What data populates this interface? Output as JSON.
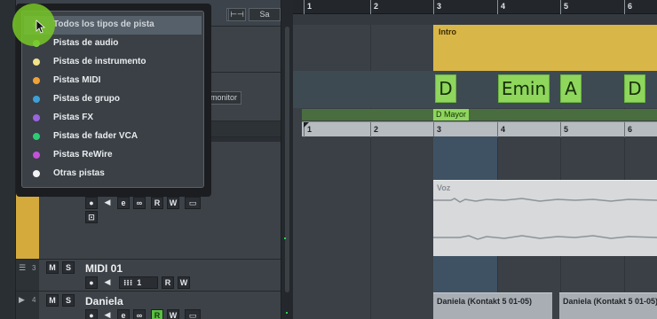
{
  "track_type_menu": {
    "items": [
      {
        "label": "Todos los tipos de pista",
        "color": "#5fa64a",
        "selected": true
      },
      {
        "label": "Pistas de audio",
        "color": "#7ed348",
        "selected": false
      },
      {
        "label": "Pistas de instrumento",
        "color": "#f2e38a",
        "selected": false
      },
      {
        "label": "Pistas MIDI",
        "color": "#f0a23a",
        "selected": false
      },
      {
        "label": "Pistas de grupo",
        "color": "#3da0d8",
        "selected": false
      },
      {
        "label": "Pistas FX",
        "color": "#9c63e0",
        "selected": false
      },
      {
        "label": "Pistas de fader VCA",
        "color": "#2ecb76",
        "selected": false
      },
      {
        "label": "Pistas ReWire",
        "color": "#c452d8",
        "selected": false
      },
      {
        "label": "Otras pistas",
        "color": "#f2f2f2",
        "selected": false
      }
    ]
  },
  "header": {
    "sa_label": "Sa",
    "monitor_label": "monitor"
  },
  "tracks": {
    "midi": {
      "number": "3",
      "name": "MIDI 01",
      "channel": "1"
    },
    "instrument": {
      "number": "4",
      "name": "Daniela"
    }
  },
  "button_labels": {
    "mute": "M",
    "solo": "S",
    "read": "R",
    "write": "W"
  },
  "ruler": {
    "bars": [
      "1",
      "2",
      "3",
      "4",
      "5",
      "6"
    ]
  },
  "arrangement": {
    "section_label": "Intro",
    "chords": [
      "D",
      "Emin",
      "A",
      "D"
    ],
    "key_label": "D Mayor",
    "audio_clip_label": "Voz",
    "midi_clips": [
      "Daniela (Kontakt 5 01-05)",
      "Daniela (Kontakt 5 01-05)"
    ]
  },
  "colors": {
    "section": "#d9b648",
    "chord": "#8ed65c",
    "accent_green": "#58c040",
    "audio_track": "#d4aa3c"
  }
}
